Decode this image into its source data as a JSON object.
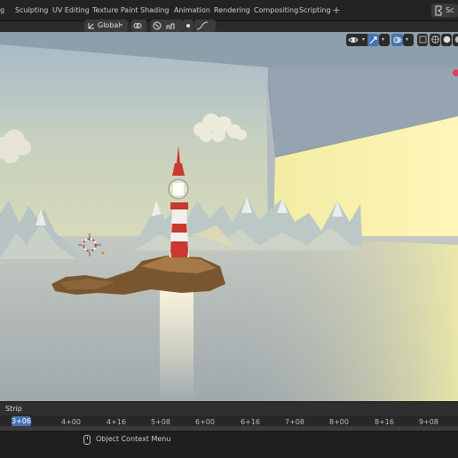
{
  "workspace_tabs": [
    {
      "label": "g",
      "active": false
    },
    {
      "label": "Sculpting",
      "active": false
    },
    {
      "label": "UV Editing",
      "active": false
    },
    {
      "label": "Texture Paint",
      "active": false
    },
    {
      "label": "Shading",
      "active": false
    },
    {
      "label": "Animation",
      "active": false
    },
    {
      "label": "Rendering",
      "active": false
    },
    {
      "label": "Compositing",
      "active": false
    },
    {
      "label": "Scripting",
      "active": false
    }
  ],
  "add_tab_label": "+",
  "scene_selector": {
    "label": "Sc"
  },
  "viewport_header": {
    "orientation_label": "Global"
  },
  "viewport": {
    "shading_mode": "rendered",
    "scene_description_icons": [
      "lighthouse",
      "mountains",
      "clouds",
      "island",
      "area-light"
    ]
  },
  "timeline": {
    "strip_label": "Strip",
    "current_frame": "3+06",
    "current_frame_trailing": "8",
    "ticks": [
      "4+00",
      "4+16",
      "5+08",
      "6+00",
      "6+16",
      "7+08",
      "8+00",
      "8+16",
      "9+08"
    ]
  },
  "status_bar": {
    "hint_text": "Object Context Menu"
  },
  "colors": {
    "accent": "#4772b3",
    "header_bg": "#232323",
    "viewport_header_bg": "#2b2b2b"
  }
}
